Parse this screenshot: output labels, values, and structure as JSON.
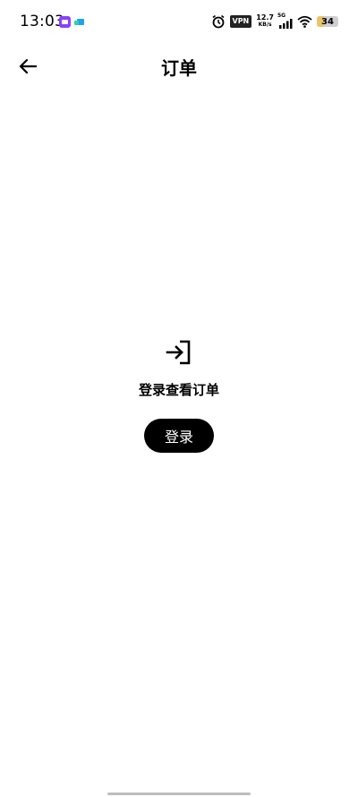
{
  "status_bar": {
    "time": "13:03",
    "vpn": "VPN",
    "speed_value": "12.7",
    "speed_unit": "KB/s",
    "network_type": "5G",
    "battery_level": "34",
    "battery_fraction": 0.34,
    "icons": [
      "messaging-app-icon",
      "app-notification-icon",
      "alarm-icon",
      "signal-icon",
      "wifi-icon",
      "battery-icon"
    ]
  },
  "header": {
    "title": "订单",
    "back_icon": "back-arrow-icon"
  },
  "empty_state": {
    "icon": "login-icon",
    "message": "登录查看订单",
    "login_button": "登录"
  }
}
